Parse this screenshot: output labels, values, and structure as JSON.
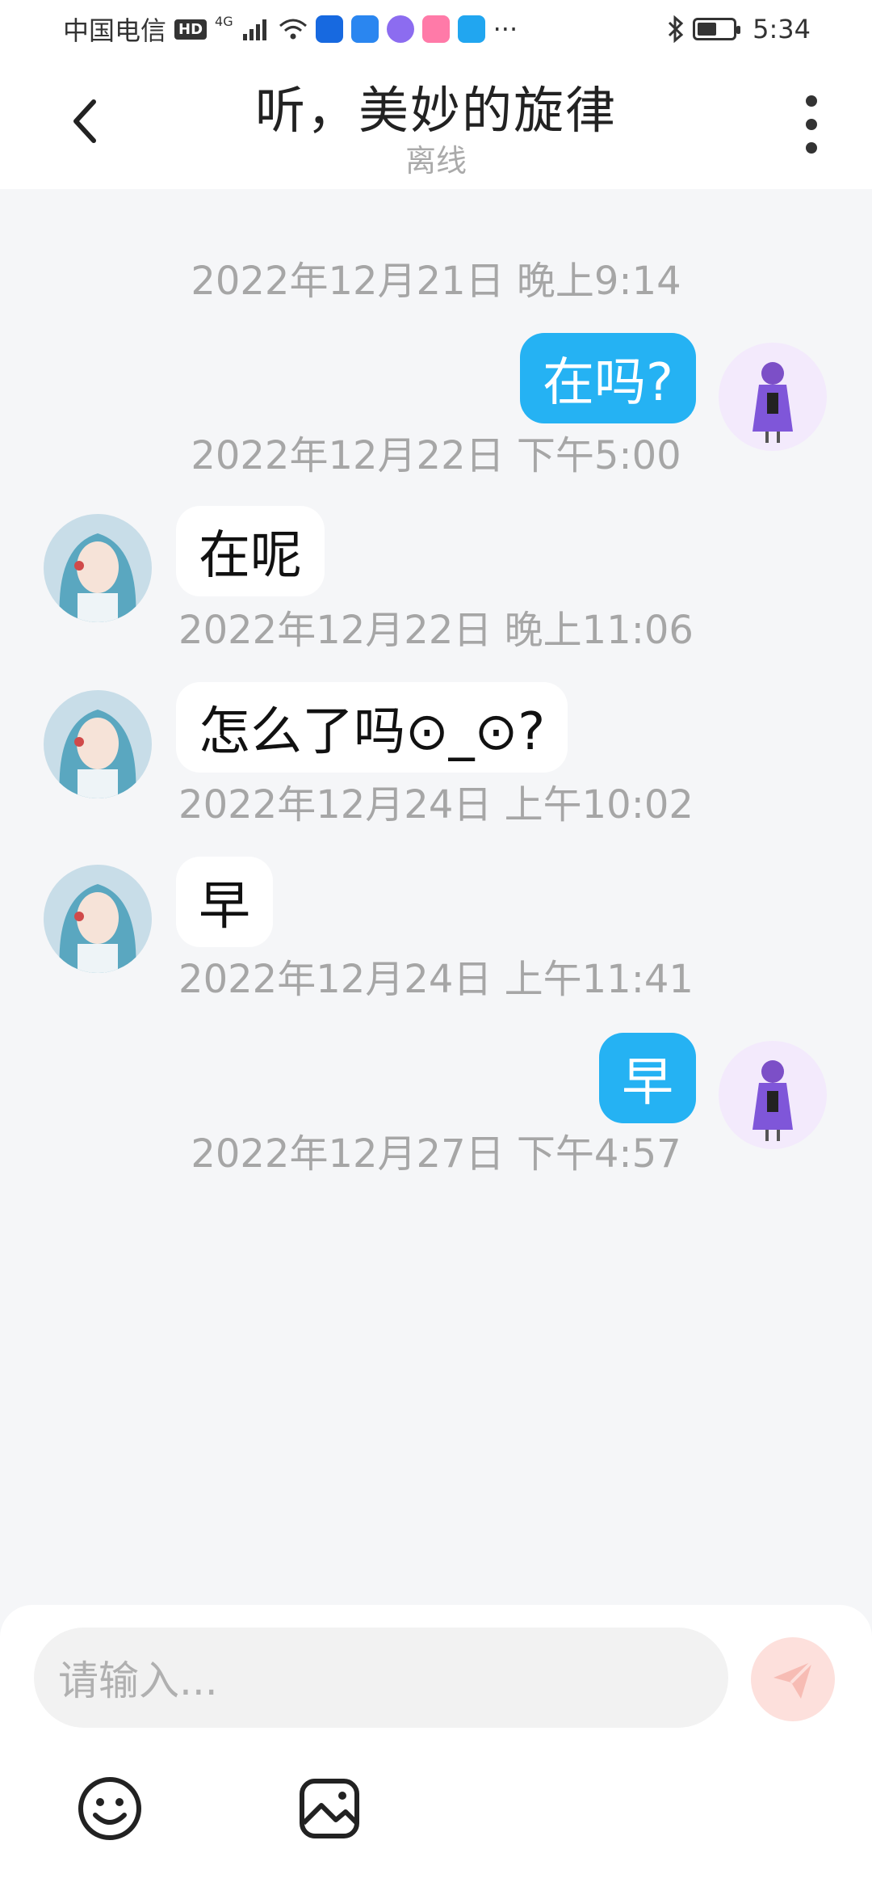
{
  "status_bar": {
    "carrier": "中国电信",
    "network_badge": "HD",
    "network_type": "4G",
    "more": "···",
    "time": "5:34",
    "battery_level": 0.55,
    "icons": [
      "signal-icon",
      "wifi-icon",
      "bluetooth-icon",
      "battery-icon"
    ]
  },
  "header": {
    "title": "听，美妙的旋律",
    "subtitle": "离线",
    "back_icon": "chevron-left-icon",
    "more_icon": "vertical-dots-icon"
  },
  "messages": [
    {
      "timestamp": "2022年12月21日 晚上9:14",
      "side": "out",
      "text": "在吗?"
    },
    {
      "timestamp": "2022年12月22日 下午5:00",
      "side": "in",
      "text": "在呢"
    },
    {
      "timestamp": "2022年12月22日 晚上11:06",
      "side": "in",
      "text": "怎么了吗⊙_⊙?"
    },
    {
      "timestamp": "2022年12月24日 上午10:02",
      "side": "in",
      "text": "早"
    },
    {
      "timestamp": "2022年12月24日 上午11:41",
      "side": "out",
      "text": "早"
    },
    {
      "timestamp": "2022年12月27日 下午4:57"
    }
  ],
  "input": {
    "placeholder": "请输入...",
    "send_icon": "send-icon",
    "tools": [
      "emoji-icon",
      "image-icon"
    ]
  },
  "colors": {
    "outgoing_bubble": "#25b2f3",
    "incoming_bubble": "#ffffff",
    "background": "#f5f6f8",
    "send_button": "#fde0dc"
  }
}
